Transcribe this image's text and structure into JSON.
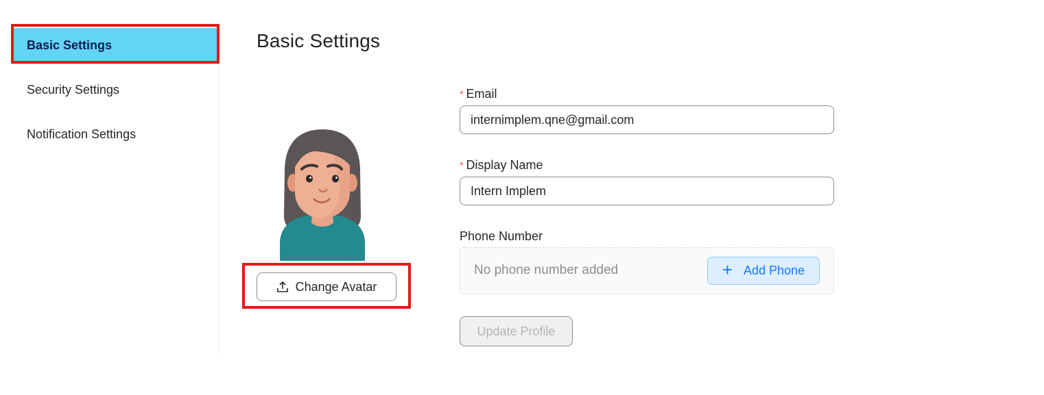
{
  "sidebar": {
    "items": [
      {
        "label": "Basic Settings",
        "active": true
      },
      {
        "label": "Security Settings",
        "active": false
      },
      {
        "label": "Notification Settings",
        "active": false
      }
    ]
  },
  "main": {
    "title": "Basic Settings",
    "avatar": {
      "icon": "avatar-female-icon",
      "change_label": "Change Avatar",
      "change_icon": "upload-icon"
    },
    "form": {
      "email": {
        "label": "Email",
        "required": true,
        "value": "internimplem.qne@gmail.com"
      },
      "display_name": {
        "label": "Display Name",
        "required": true,
        "value": "Intern Implem"
      },
      "phone": {
        "label": "Phone Number",
        "empty_text": "No phone number added",
        "add_label": "Add Phone",
        "add_icon": "plus-icon"
      },
      "submit_label": "Update Profile"
    }
  },
  "colors": {
    "sidebar_active_bg": "#63d4f4",
    "sidebar_active_text": "#0b1f4d",
    "highlight_box": "#e01b1b",
    "required_mark": "#ff4d4f",
    "primary": "#1677ff",
    "add_phone_bg": "#dceeff"
  }
}
